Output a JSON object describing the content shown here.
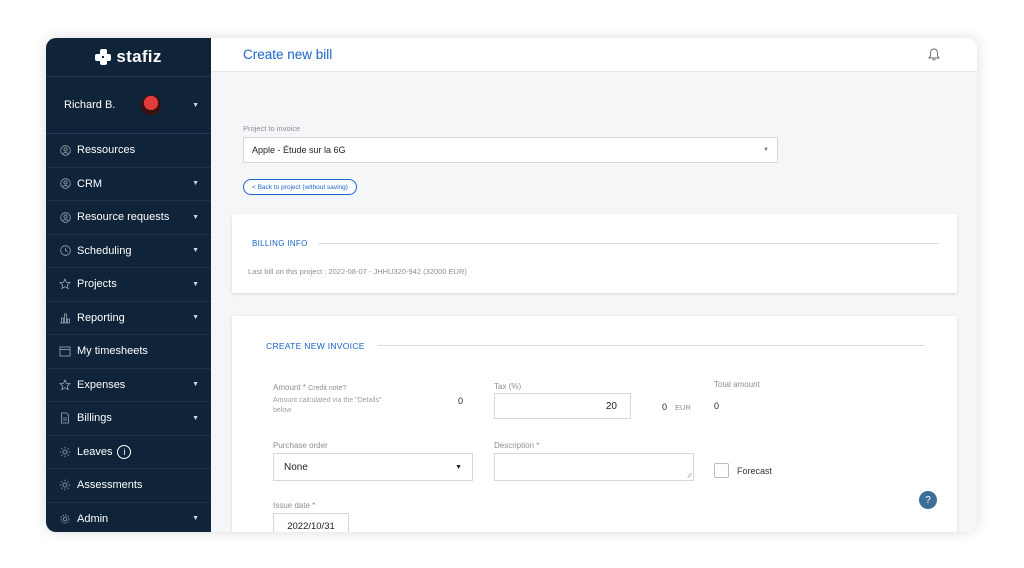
{
  "app": {
    "logo_text": "stafiz"
  },
  "user": {
    "name": "Richard B."
  },
  "sidebar": {
    "items": [
      {
        "label": "Ressources",
        "icon": "user-circle-icon",
        "has_caret": false
      },
      {
        "label": "CRM",
        "icon": "user-circle-icon",
        "has_caret": true
      },
      {
        "label": "Resource requests",
        "icon": "user-circle-icon",
        "has_caret": true
      },
      {
        "label": "Scheduling",
        "icon": "clock-icon",
        "has_caret": true
      },
      {
        "label": "Projects",
        "icon": "star-icon",
        "has_caret": true
      },
      {
        "label": "Reporting",
        "icon": "bar-chart-icon",
        "has_caret": true
      },
      {
        "label": "My timesheets",
        "icon": "calendar-icon",
        "has_caret": false
      },
      {
        "label": "Expenses",
        "icon": "star-icon",
        "has_caret": true
      },
      {
        "label": "Billings",
        "icon": "document-icon",
        "has_caret": true
      },
      {
        "label": "Leaves",
        "icon": "sun-icon",
        "has_caret": false,
        "badge": "i"
      },
      {
        "label": "Assessments",
        "icon": "sun-icon",
        "has_caret": false
      },
      {
        "label": "Admin",
        "icon": "gear-icon",
        "has_caret": true
      }
    ]
  },
  "header": {
    "title": "Create new bill"
  },
  "project": {
    "label": "Project to invoice",
    "value": "Apple - Étude sur la 6G",
    "back_label": "< Back to project (without saving)"
  },
  "billing_info": {
    "title": "BILLING INFO",
    "last_bill": "Last bill on this project : 2022-08-07 - JHHU320-942 (32000 EUR)"
  },
  "invoice": {
    "title": "CREATE NEW INVOICE",
    "amount_label": "Amount *",
    "credit_note_label": "Credit note?",
    "amount_hint": "Amount calculated via the \"Details\" below",
    "amount_value": "0",
    "tax_label": "Tax (%)",
    "tax_value": "20",
    "tax_amount": "0",
    "currency": "EUR",
    "total_label": "Total amount",
    "total_value": "0",
    "po_label": "Purchase order",
    "po_value": "None",
    "description_label": "Description *",
    "description_value": "",
    "forecast_label": "Forecast",
    "forecast_checked": false,
    "issue_date_label": "Issue date *",
    "issue_date_value": "2022/10/31"
  },
  "colors": {
    "sidebar_bg": "#0f2438",
    "accent": "#1a63c7",
    "help_button": "#3d6f99"
  }
}
